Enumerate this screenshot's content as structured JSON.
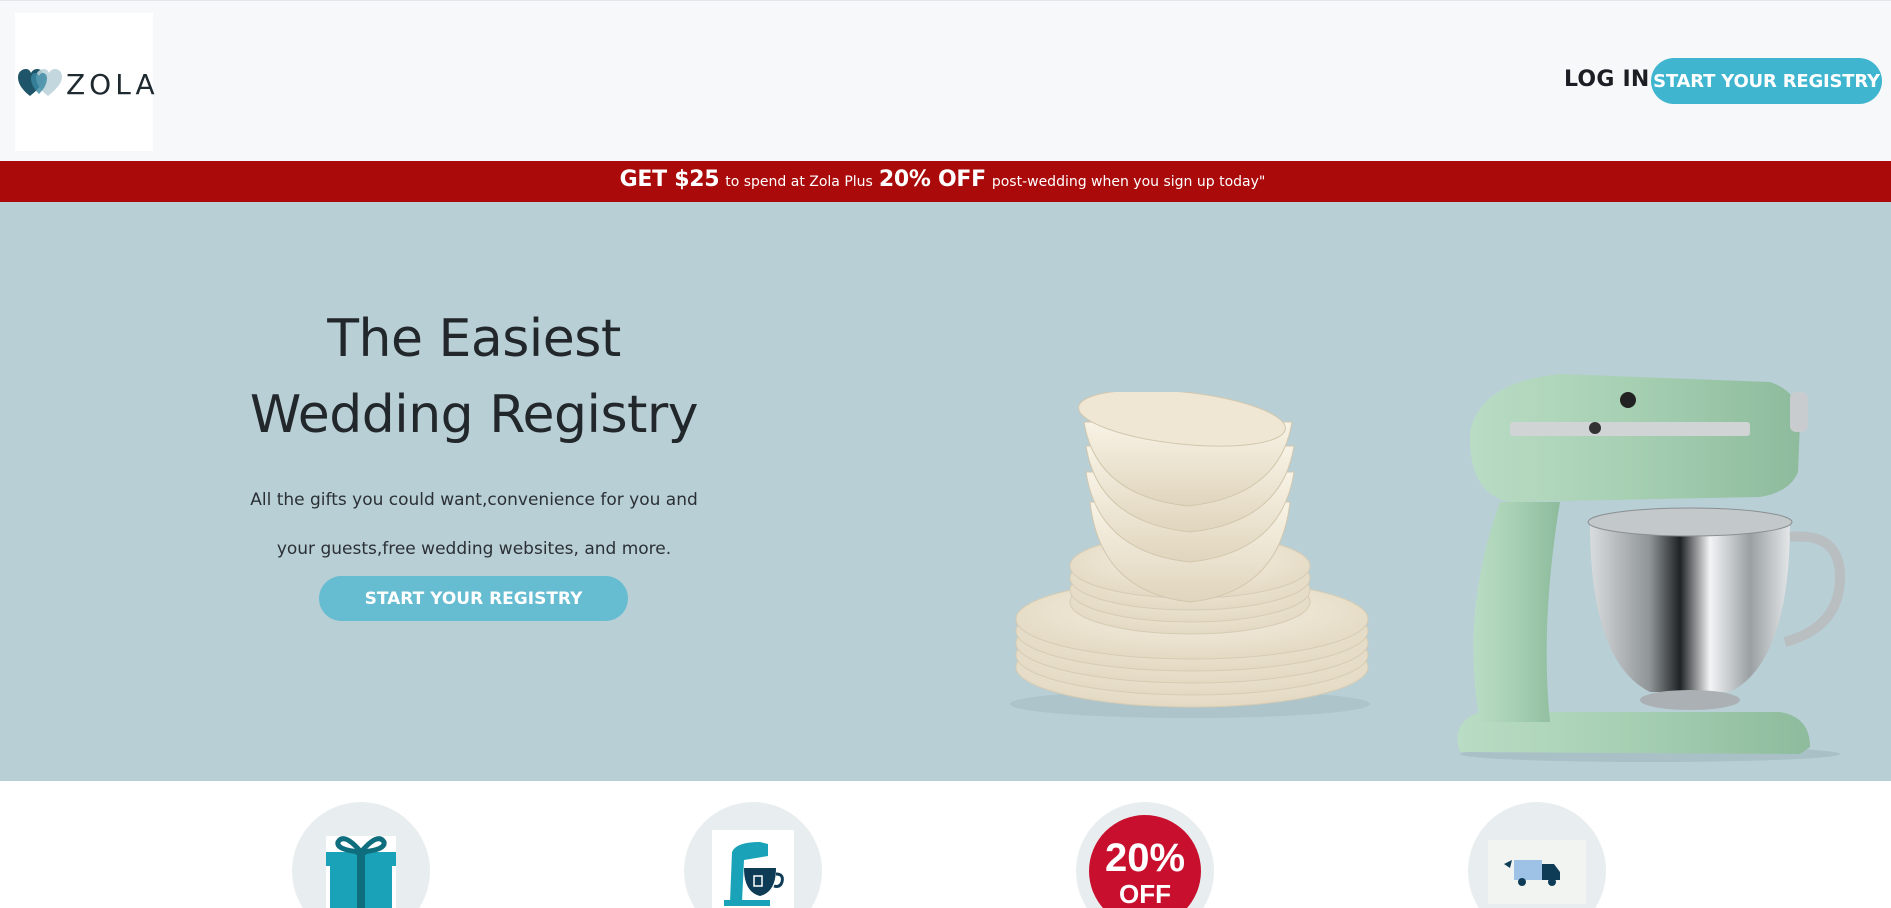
{
  "header": {
    "logo_text": "ZOLA",
    "login_label": "LOG IN",
    "cta_label": "START YOUR REGISTRY"
  },
  "promo": {
    "part1_big": "GET $25",
    "part1_small": "to spend at Zola Plus",
    "part2_big": "20% OFF",
    "part2_small": "post-wedding when you sign up today\""
  },
  "hero": {
    "title_line1": "The Easiest",
    "title_line2": "Wedding Registry",
    "subtitle_line1": "All the gifts you could want,convenience for you and",
    "subtitle_line2": "your guests,free wedding websites, and more.",
    "cta_label": "START YOUR REGISTRY",
    "images": [
      "dishes-stack-image",
      "stand-mixer-image"
    ]
  },
  "features": {
    "icons": [
      "gift-icon",
      "mixer-icon",
      "discount-badge-icon",
      "delivery-truck-icon"
    ],
    "discount_line1": "20%",
    "discount_line2": "OFF"
  },
  "colors": {
    "header_bg": "#f7f8fa",
    "accent": "#3fb5cf",
    "promo_bg": "#aa0a0a",
    "hero_bg": "#b8cfd6",
    "hero_cta": "#66bcd0"
  }
}
